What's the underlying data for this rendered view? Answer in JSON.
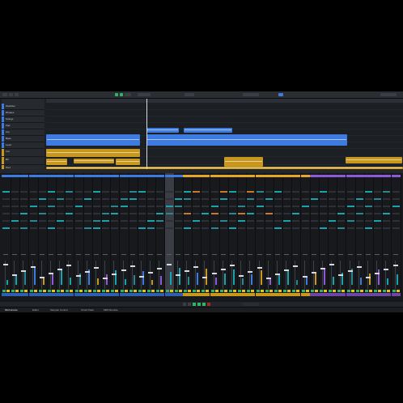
{
  "colors": {
    "accent_blue": "#3d7be0",
    "accent_gold": "#c8971d",
    "accent_green": "#2fb56a",
    "accent_teal": "#19a3ad",
    "accent_orange": "#c8782f",
    "accent_purple": "#8f5ad8",
    "panel_bg": "#141619"
  },
  "toolbar": {
    "icons": [
      "project-icon",
      "undo-icon",
      "redo-icon",
      "select-tool-icon",
      "snap-icon",
      "quantize-icon"
    ]
  },
  "tracks": [
    {
      "name": "Wurlitzer",
      "color": "#3d7be0"
    },
    {
      "name": "Rhodes",
      "color": "#3d7be0"
    },
    {
      "name": "Strings",
      "color": "#3d7be0"
    },
    {
      "name": "Pad",
      "color": "#3d7be0"
    },
    {
      "name": "Arp",
      "color": "#3d7be0"
    },
    {
      "name": "Bass",
      "color": "#3d7be0"
    },
    {
      "name": "Lead",
      "color": "#3d7be0"
    },
    {
      "name": "Vox",
      "color": "#c8971d"
    },
    {
      "name": "BV",
      "color": "#c8971d"
    },
    {
      "name": "Perc",
      "color": "#c8971d"
    }
  ],
  "mixer": {
    "strip_count": 44,
    "selected_strip": 18
  },
  "status": {
    "tabs": [
      "MixConsole",
      "Editor",
      "Sampler Control",
      "Chord Pads",
      "MIDI Remote"
    ]
  }
}
